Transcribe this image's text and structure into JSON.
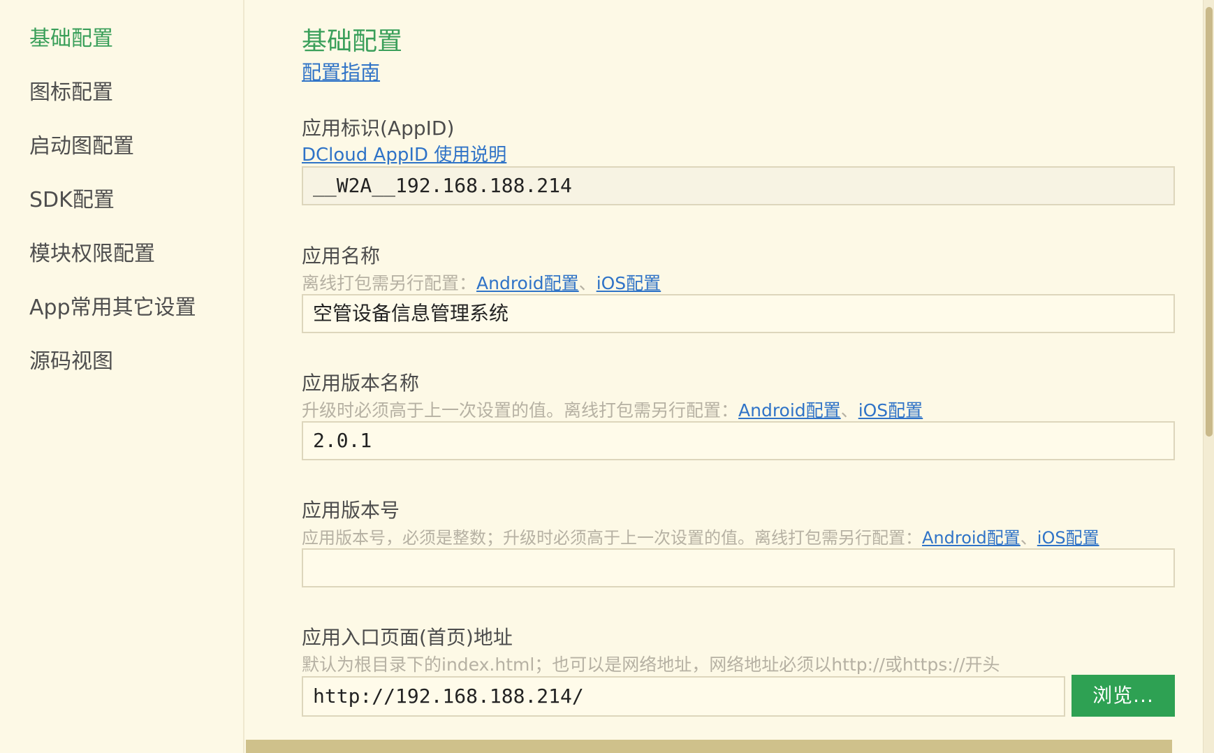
{
  "sidebar": {
    "items": [
      {
        "label": "基础配置"
      },
      {
        "label": "图标配置"
      },
      {
        "label": "启动图配置"
      },
      {
        "label": "SDK配置"
      },
      {
        "label": "模块权限配置"
      },
      {
        "label": "App常用其它设置"
      },
      {
        "label": "源码视图"
      }
    ],
    "active_index": 0
  },
  "main": {
    "title": "基础配置",
    "guide_link": "配置指南",
    "appid": {
      "label": "应用标识(AppID)",
      "link": "DCloud AppID 使用说明",
      "value": "__W2A__192.168.188.214"
    },
    "app_name": {
      "label": "应用名称",
      "hint": "离线打包需另行配置：",
      "android_link": "Android配置",
      "separator": "、",
      "ios_link": "iOS配置",
      "value": "空管设备信息管理系统"
    },
    "version_name": {
      "label": "应用版本名称",
      "hint": "升级时必须高于上一次设置的值。离线打包需另行配置：",
      "android_link": "Android配置",
      "separator": "、",
      "ios_link": "iOS配置",
      "value": "2.0.1"
    },
    "version_code": {
      "label": "应用版本号",
      "hint": "应用版本号，必须是整数；升级时必须高于上一次设置的值。离线打包需另行配置：",
      "android_link": "Android配置",
      "separator": "、",
      "ios_link": "iOS配置",
      "value": ""
    },
    "entry_page": {
      "label": "应用入口页面(首页)地址",
      "hint": "默认为根目录下的index.html；也可以是网络地址，网络地址必须以http://或https://开头",
      "value": "http://192.168.188.214/",
      "browse_label": "浏览..."
    }
  },
  "colors": {
    "background": "#fdf9e6",
    "accent_green": "#3a9f5a",
    "link_blue": "#2f73c7",
    "button_green": "#2ea153"
  }
}
